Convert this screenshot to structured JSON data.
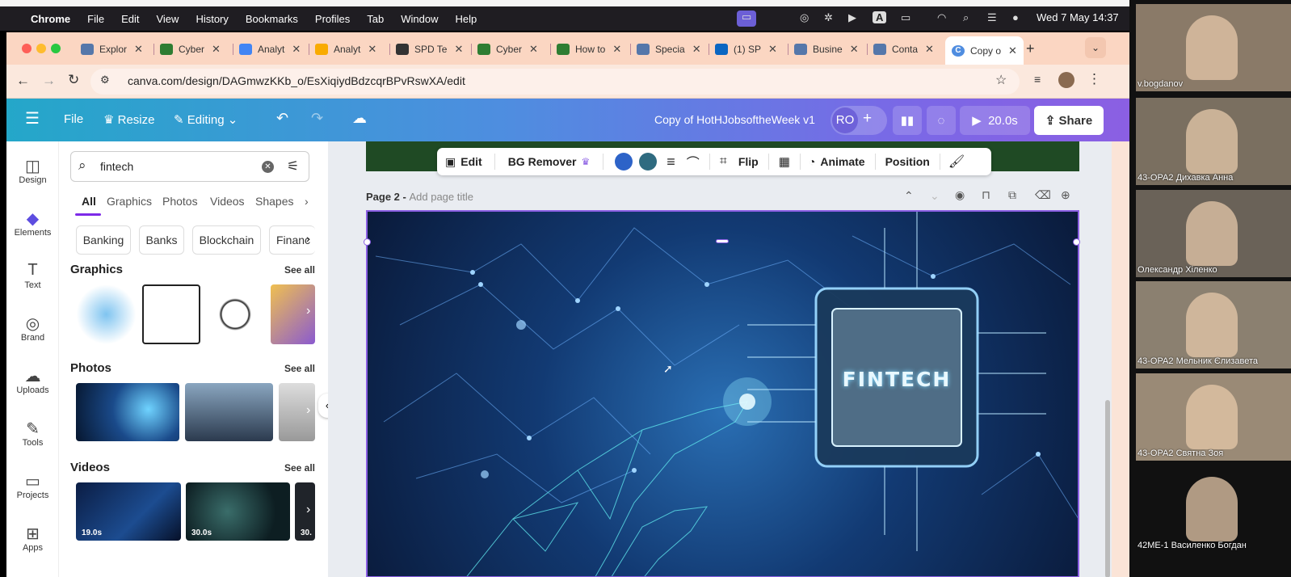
{
  "os_menubar": {
    "app": "Chrome",
    "items": [
      "File",
      "Edit",
      "View",
      "History",
      "Bookmarks",
      "Profiles",
      "Tab",
      "Window",
      "Help"
    ],
    "clock": "Wed 7 May  14:37"
  },
  "browser": {
    "tabs": [
      {
        "label": "Explor",
        "color": "#5577aa"
      },
      {
        "label": "Cyber",
        "color": "#2e7d32"
      },
      {
        "label": "Analyt",
        "color": "#4285f4"
      },
      {
        "label": "Analyt",
        "color": "#f9ab00"
      },
      {
        "label": "SPD Te",
        "color": "#333"
      },
      {
        "label": "Cyber",
        "color": "#2e7d32"
      },
      {
        "label": "How to",
        "color": "#2e7d32"
      },
      {
        "label": "Specia",
        "color": "#5577aa"
      },
      {
        "label": "(1) SP",
        "color": "#0a66c2"
      },
      {
        "label": "Busine",
        "color": "#5577aa"
      },
      {
        "label": "Conta",
        "color": "#5577aa"
      }
    ],
    "active_tab": "Copy o",
    "url": "canva.com/design/DAGmwzKKb_o/EsXiqiydBdzcqrBPvRswXA/edit"
  },
  "canva_header": {
    "file": "File",
    "resize": "Resize",
    "editing": "Editing",
    "title": "Copy of HotHJobsoftheWeek v1",
    "avatar": "RO",
    "play_time": "20.0s",
    "share": "Share"
  },
  "rail": [
    {
      "label": "Design",
      "icon": "design-icon",
      "glyph": "◫"
    },
    {
      "label": "Elements",
      "icon": "elements-icon",
      "glyph": "◆"
    },
    {
      "label": "Text",
      "icon": "text-icon",
      "glyph": "T"
    },
    {
      "label": "Brand",
      "icon": "brand-icon",
      "glyph": "◎"
    },
    {
      "label": "Uploads",
      "icon": "uploads-icon",
      "glyph": "☁"
    },
    {
      "label": "Tools",
      "icon": "tools-icon",
      "glyph": "✎"
    },
    {
      "label": "Projects",
      "icon": "projects-icon",
      "glyph": "▭"
    },
    {
      "label": "Apps",
      "icon": "apps-icon",
      "glyph": "⊞"
    }
  ],
  "panel": {
    "search_value": "fintech",
    "tabs": [
      "All",
      "Graphics",
      "Photos",
      "Videos",
      "Shapes"
    ],
    "chips": [
      "Banking",
      "Banks",
      "Blockchain",
      "Financ"
    ],
    "graphics_title": "Graphics",
    "photos_title": "Photos",
    "videos_title": "Videos",
    "see_all": "See all",
    "video_durations": [
      "19.0s",
      "30.0s",
      "30."
    ]
  },
  "canvas": {
    "toolbar": {
      "edit": "Edit",
      "bg_remover": "BG Remover",
      "flip": "Flip",
      "animate": "Animate",
      "position": "Position"
    },
    "page_label": "Page 2 - ",
    "page_title_placeholder": "Add page title",
    "design_text": "FINTECH"
  },
  "participants": [
    {
      "name": "v.bogdanov",
      "bg": "#8a7a68"
    },
    {
      "name": "43-ОРА2 Дихавка Анна",
      "bg": "#7a6f60"
    },
    {
      "name": "Олександр Хіленко",
      "bg": "#6a6258"
    },
    {
      "name": "43-ОРА2 Мельник Єлизавета",
      "bg": "#8b8070"
    },
    {
      "name": "43-ОРА2 Святна Зоя",
      "bg": "#9a8a76"
    },
    {
      "name": "42МЕ-1 Василенко Богдан",
      "bg": "#111111"
    }
  ]
}
